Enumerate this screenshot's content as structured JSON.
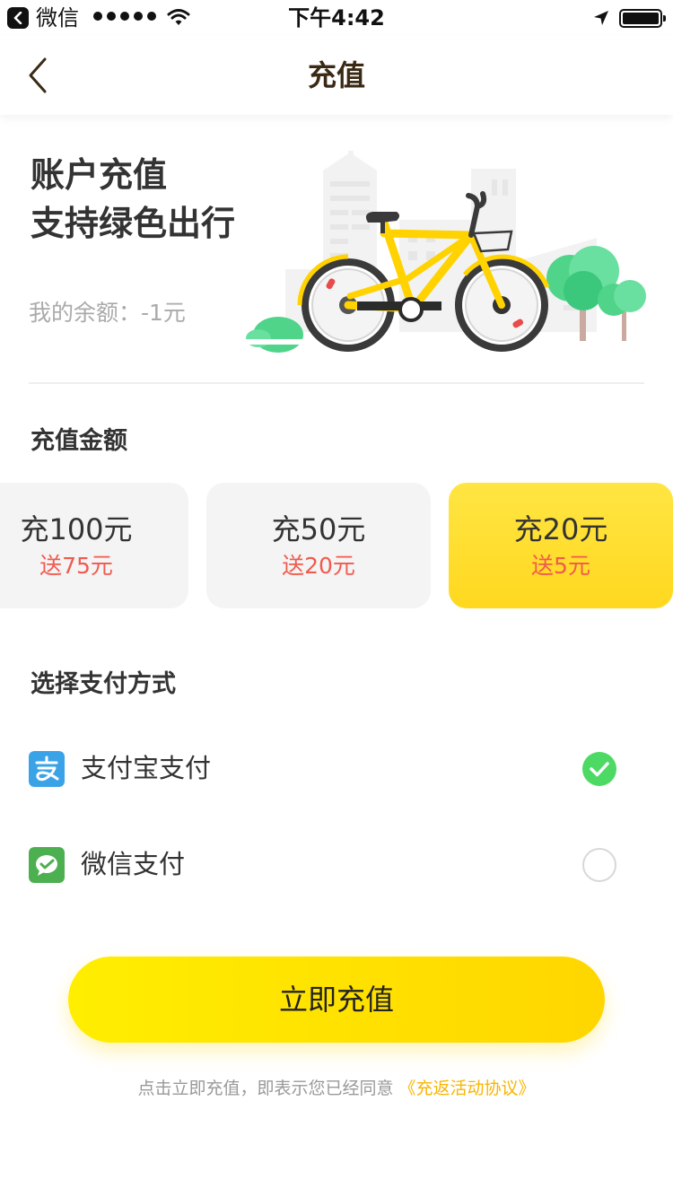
{
  "status_bar": {
    "app_name": "微信",
    "time": "下午4:42",
    "signal_icon": "signal-dots-icon",
    "wifi_icon": "wifi-icon",
    "location_icon": "location-arrow-icon",
    "battery_icon": "battery-icon"
  },
  "nav": {
    "title": "充值",
    "back_icon": "chevron-left-icon"
  },
  "hero": {
    "title_line1": "账户充值",
    "title_line2": "支持绿色出行",
    "balance": "我的余额：-1元"
  },
  "amounts": {
    "section_label": "充值金额",
    "options": [
      {
        "amount": "充100元",
        "bonus": "送75元",
        "selected": false
      },
      {
        "amount": "充50元",
        "bonus": "送20元",
        "selected": false
      },
      {
        "amount": "充20元",
        "bonus": "送5元",
        "selected": true
      }
    ]
  },
  "payment": {
    "section_label": "选择支付方式",
    "methods": [
      {
        "label": "支付宝支付",
        "icon": "alipay-icon",
        "selected": true
      },
      {
        "label": "微信支付",
        "icon": "wechat-pay-icon",
        "selected": false
      }
    ]
  },
  "cta": {
    "label": "立即充值"
  },
  "agreement": {
    "text": "点击立即充值，即表示您已经同意",
    "link": "《充返活动协议》"
  },
  "colors": {
    "accent_yellow": "#ffd600",
    "bonus_red": "#f05a4f",
    "check_green": "#4cd964",
    "alipay_blue": "#3aa3e8",
    "wechat_green": "#4caf50",
    "link_gold": "#f7b500"
  }
}
